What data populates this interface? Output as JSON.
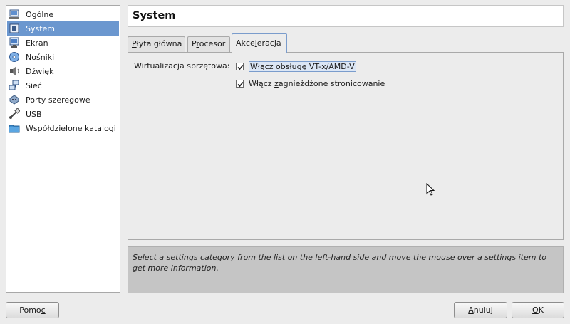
{
  "sidebar": {
    "items": [
      {
        "label": "Ogólne",
        "icon": "monitor-icon",
        "selected": false
      },
      {
        "label": "System",
        "icon": "chip-icon",
        "selected": true
      },
      {
        "label": "Ekran",
        "icon": "display-icon",
        "selected": false
      },
      {
        "label": "Nośniki",
        "icon": "disc-icon",
        "selected": false
      },
      {
        "label": "Dźwięk",
        "icon": "speaker-icon",
        "selected": false
      },
      {
        "label": "Sieć",
        "icon": "network-icon",
        "selected": false
      },
      {
        "label": "Porty szeregowe",
        "icon": "serial-port-icon",
        "selected": false
      },
      {
        "label": "USB",
        "icon": "usb-icon",
        "selected": false
      },
      {
        "label": "Współdzielone katalogi",
        "icon": "folder-icon",
        "selected": false
      }
    ]
  },
  "header": {
    "title": "System"
  },
  "tabs": [
    {
      "pre": "",
      "mnemonic": "P",
      "post": "łyta główna",
      "active": false
    },
    {
      "pre": "P",
      "mnemonic": "r",
      "post": "ocesor",
      "active": false
    },
    {
      "pre": "Akce",
      "mnemonic": "l",
      "post": "eracja",
      "active": true
    }
  ],
  "acceleration": {
    "virtualization_label": "Wirtualizacja sprzętowa:",
    "vtx": {
      "pre": "Włącz obsługę ",
      "mnemonic": "V",
      "post": "T-x/AMD-V",
      "checked": true
    },
    "nested_paging": {
      "pre": "Włącz ",
      "mnemonic": "z",
      "post": "agnieżdżone stronicowanie",
      "checked": true
    }
  },
  "info": {
    "text": "Select a settings category from the list on the left-hand side and move the mouse over a settings item to get more information."
  },
  "buttons": {
    "help": {
      "pre": "Pomo",
      "mnemonic": "c",
      "post": ""
    },
    "cancel": {
      "pre": "",
      "mnemonic": "A",
      "post": "nuluj"
    },
    "ok": {
      "pre": "",
      "mnemonic": "O",
      "post": "K"
    }
  },
  "colors": {
    "selection": "#6b97cf",
    "window_bg": "#ececec",
    "info_bg": "#c5c5c5"
  }
}
